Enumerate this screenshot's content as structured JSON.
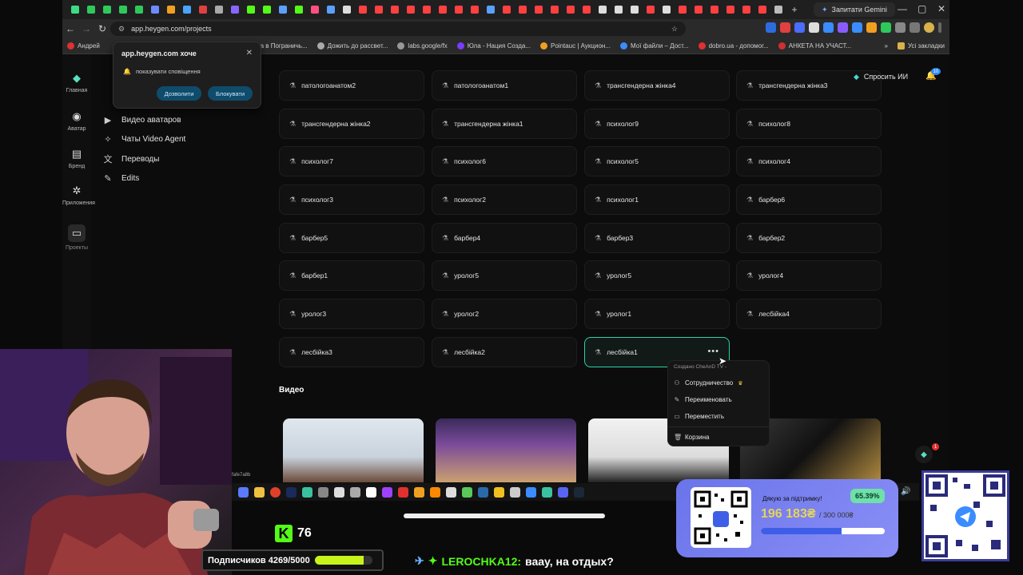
{
  "browser": {
    "url": "app.heygen.com/projects",
    "gemini_tab": "Запитати Gemini",
    "all_bookmarks": "Усі закладки",
    "bookmarks": [
      "Андрей",
      "Аліса в Пограничь...",
      "Дожить до рассвет...",
      "labs.google/fx",
      "Юла - Нация Созда...",
      "Pointauc | Аукцион...",
      "Мої файли – Дост...",
      "dobro.ua - допомог...",
      "АНКЕТА НА УЧАСТ..."
    ]
  },
  "notification": {
    "title": "app.heygen.com хоче",
    "message": "показувати сповіщення",
    "allow": "Дозволити",
    "block": "Блокувати"
  },
  "rail": {
    "items": [
      {
        "label": "Главная",
        "icon": "home-icon"
      },
      {
        "label": "Аватар",
        "icon": "avatar-icon"
      },
      {
        "label": "Бренд",
        "icon": "brand-icon"
      },
      {
        "label": "Приложения",
        "icon": "apps-icon"
      },
      {
        "label": "Проекты",
        "icon": "folder-icon"
      }
    ]
  },
  "sidenav": {
    "items": [
      "Видео аватаров",
      "Чаты Video Agent",
      "Переводы",
      "Edits"
    ]
  },
  "header": {
    "ask_ai": "Спросить ИИ",
    "notif_count": "10"
  },
  "folders": [
    "патологоанатом2",
    "патологоанатом1",
    "трансгендерна жінка4",
    "трансгендерна жінка3",
    "трансгендерна жінка2",
    "трансгендерна жінка1",
    "психолог9",
    "психолог8",
    "психолог7",
    "психолог6",
    "психолог5",
    "психолог4",
    "психолог3",
    "психолог2",
    "психолог1",
    "барбер6",
    "барбер5",
    "барбер4",
    "барбер3",
    "барбер2",
    "барбер1",
    "уролог5",
    "уролог5",
    "уролог4",
    "уролог3",
    "уролог2",
    "уролог1",
    "лесбійка4",
    "лесбійка3",
    "лесбійка2",
    "лесбійка1"
  ],
  "videos_title": "Видео",
  "context_menu": {
    "header": "Создано CheAnD TV -",
    "items": [
      "Сотрудничество",
      "Переименовать",
      "Переместить",
      "Корзина"
    ]
  },
  "stream": {
    "kick_count": "76",
    "subs_label": "Подписчиков 4269/5000",
    "subs_progress": 0.8538,
    "chat_user": "LEROCHKA12:",
    "chat_text": "ваау, на отдых?",
    "donate_title": "Дякую за підтримку!",
    "donate_amount": "196 183₴",
    "donate_goal": "/ 300 000₴",
    "donate_percent": "65.39%",
    "donate_progress": 0.6539,
    "small_text": "fafe7a8b",
    "badge_count": "1"
  },
  "colors": {
    "accent": "#2bd1a5",
    "kick_green": "#53fc18",
    "notif_button": "#0f4c6c"
  }
}
